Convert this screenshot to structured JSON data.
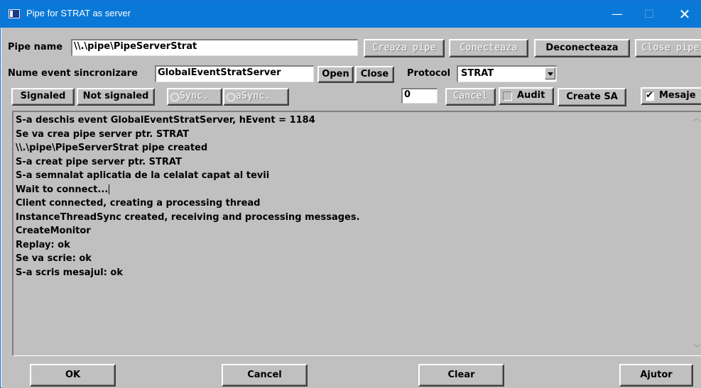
{
  "window": {
    "title": "Pipe for STRAT as server",
    "minimize": "—",
    "maximize": "☐",
    "close": "✕"
  },
  "pipe": {
    "label": "Pipe name",
    "value": "\\\\.\\pipe\\PipeServerStrat",
    "buttons": {
      "creaza": "Creaza pipe",
      "conecteaza": "Conecteaza",
      "deconecteaza": "Deconecteaza",
      "close": "Close pipe"
    }
  },
  "event": {
    "label": "Nume event sincronizare",
    "value": "GlobalEventStratServer",
    "open": "Open",
    "close": "Close",
    "protocol_label": "Protocol",
    "protocol_value": "STRAT"
  },
  "row3": {
    "signaled": "Signaled",
    "not_signaled": "Not signaled",
    "sync": "Sync.",
    "async": "aSync.",
    "count_value": "0",
    "cancel": "Cancel",
    "audit": "Audit",
    "create_sa": "Create SA",
    "mesaje": "Mesaje",
    "mesaje_checked": true,
    "audit_checked": false
  },
  "log": {
    "lines": [
      "S-a deschis event GlobalEventStratServer, hEvent = 1184",
      "Se va crea pipe server ptr. STRAT",
      "\\\\.\\pipe\\PipeServerStrat  pipe created",
      "S-a creat pipe server ptr. STRAT",
      "S-a semnalat aplicatia de la celalat capat al tevii",
      "Wait to connect...",
      "Client connected, creating a processing thread",
      "InstanceThreadSync created, receiving and processing messages.",
      "CreateMonitor",
      "Replay: ok",
      "Se va scrie: ok",
      "S-a scris mesajul: ok"
    ]
  },
  "footer": {
    "ok": "OK",
    "cancel": "Cancel",
    "clear": "Clear",
    "ajutor": "Ajutor"
  },
  "colors": {
    "titlebar": "#0a78d7",
    "face": "#c0c0c0"
  }
}
